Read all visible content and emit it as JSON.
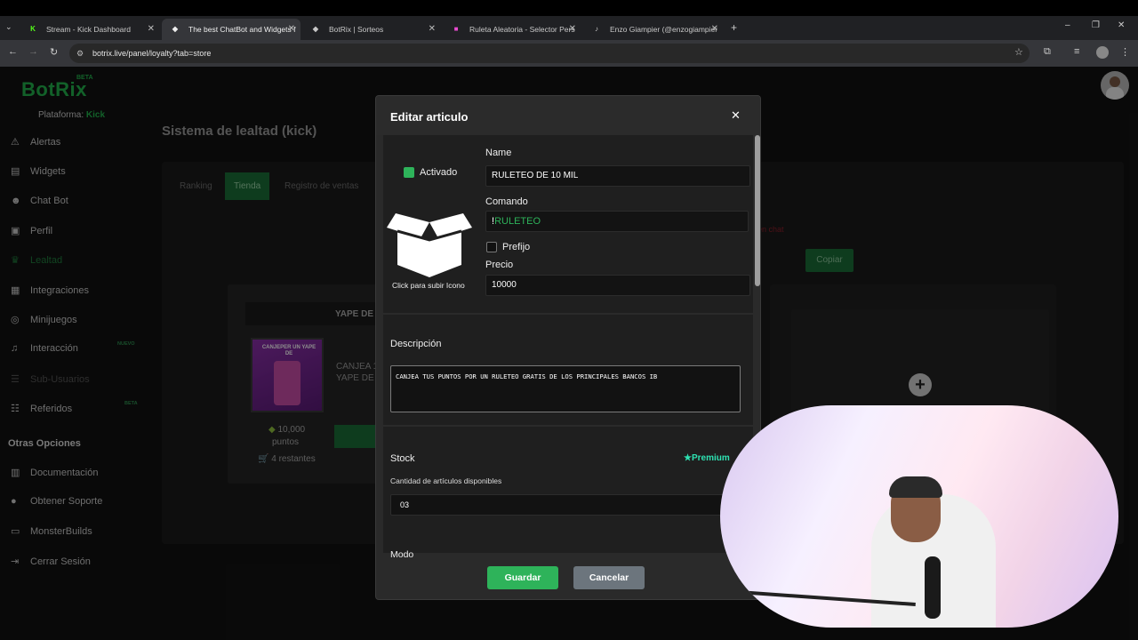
{
  "browser": {
    "tabs": [
      {
        "label": "Stream - Kick Dashboard",
        "favicon": "K",
        "fav_color": "#53fc18"
      },
      {
        "label": "The best ChatBot and Widgets f",
        "favicon": "◆",
        "fav_color": "#ffffff"
      },
      {
        "label": "BotRix | Sorteos",
        "favicon": "◆",
        "fav_color": "#ffffff"
      },
      {
        "label": "Ruleta Aleatoria - Selector Pers",
        "favicon": "■",
        "fav_color": "#e94bd0"
      },
      {
        "label": "Enzo Giampier (@enzogiampier",
        "favicon": "♪",
        "fav_color": "#ffffff"
      }
    ],
    "url": "botrix.live/panel/loyalty?tab=store"
  },
  "sidebar": {
    "logo": "BotRix",
    "logo_badge": "BETA",
    "platform_label": "Plataforma:",
    "platform_value": "Kick",
    "items": [
      {
        "label": "Alertas",
        "icon": "warning-icon"
      },
      {
        "label": "Widgets",
        "icon": "layers-icon"
      },
      {
        "label": "Chat Bot",
        "icon": "robot-icon"
      },
      {
        "label": "Perfil",
        "icon": "id-card-icon"
      },
      {
        "label": "Lealtad",
        "icon": "trophy-icon"
      },
      {
        "label": "Integraciones",
        "icon": "plugin-icon"
      },
      {
        "label": "Minijuegos",
        "icon": "gamepad-icon"
      },
      {
        "label": "Interacción",
        "icon": "music-icon"
      },
      {
        "label": "Sub-Usuarios",
        "icon": "users-icon"
      },
      {
        "label": "Referidos",
        "icon": "people-icon"
      }
    ],
    "badge_nuevo": "NUEVO",
    "badge_beta": "BETA",
    "other_section": "Otras Opciones",
    "other_items": [
      {
        "label": "Documentación",
        "icon": "book-icon"
      },
      {
        "label": "Obtener Soporte",
        "icon": "support-icon"
      },
      {
        "label": "MonsterBuilds",
        "icon": "monitor-icon"
      },
      {
        "label": "Cerrar Sesión",
        "icon": "logout-icon"
      }
    ]
  },
  "main": {
    "title": "Sistema de lealtad (kick)",
    "tabs": [
      "Ranking",
      "Tienda",
      "Registro de ventas"
    ],
    "active_tab": "Tienda",
    "card": {
      "title": "YAPE DE",
      "description": "CANJEA 1... YAPE DE",
      "points": "10,000",
      "points_unit": "puntos",
      "remaining": "4 restantes",
      "image_text": "CANJEPER UN YAPE DE"
    },
    "copy_button": "Copiar",
    "hint_text": "en chat"
  },
  "modal": {
    "title": "Editar articulo",
    "activated_label": "Activado",
    "upload_label": "Click para subir Icono",
    "name_label": "Name",
    "name_value": "RULETEO DE 10 MIL",
    "command_label": "Comando",
    "command_prefix": "!",
    "command_value": "RULETEO",
    "prefix_label": "Prefijo",
    "price_label": "Precio",
    "price_value": "10000",
    "description_label": "Descripción",
    "description_value": "CANJEA TUS PUNTOS POR UN RULETEO GRATIS DE LOS PRINCIPALES BANCOS IB",
    "stock_label": "Stock",
    "premium_label": "Premium",
    "stock_hint": "Cantidad de artículos disponibles",
    "stock_value": "03",
    "mode_label": "Modo",
    "save_button": "Guardar",
    "cancel_button": "Cancelar"
  },
  "colors": {
    "accent": "#2eb35a",
    "save": "#2eb35a",
    "cancel": "#6c757d",
    "premium": "#2ee3b3"
  }
}
